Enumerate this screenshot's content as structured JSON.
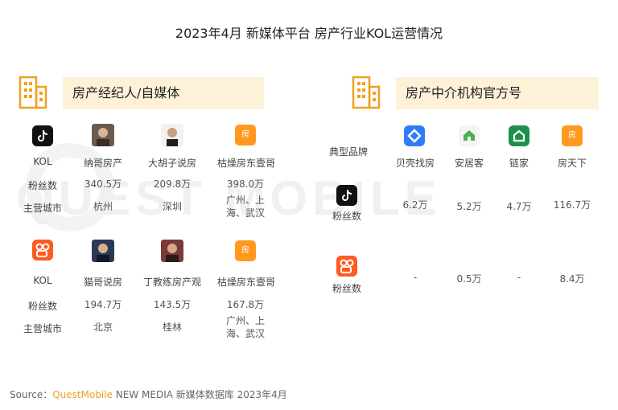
{
  "title": "2023年4月 新媒体平台 房产行业KOL运营情况",
  "watermark": "QUEST MOBILE",
  "left_section": {
    "header": "房产经纪人/自媒体",
    "row_labels": {
      "kol": "KOL",
      "fans": "粉丝数",
      "city": "主营城市"
    },
    "douyin": [
      {
        "name": "纳哥房产",
        "fans": "340.5万",
        "city": "杭州"
      },
      {
        "name": "大胡子说房",
        "fans": "209.8万",
        "city": "深圳"
      },
      {
        "name": "枯燥房东壹哥",
        "fans": "398.0万",
        "city_line1": "广州、上",
        "city_line2": "海、武汉"
      }
    ],
    "kuaishou": [
      {
        "name": "猫哥说房",
        "fans": "194.7万",
        "city": "北京"
      },
      {
        "name": "丁教练房产观",
        "fans": "143.5万",
        "city": "桂林"
      },
      {
        "name": "枯燥房东壹哥",
        "fans": "167.8万",
        "city_line1": "广州、上",
        "city_line2": "海、武汉"
      }
    ]
  },
  "right_section": {
    "header": "房产中介机构官方号",
    "brand_label": "典型品牌",
    "fans_label": "粉丝数",
    "brands": [
      "贝壳找房",
      "安居客",
      "链家",
      "房天下"
    ],
    "fang_glyph": "房",
    "douyin_fans": [
      "6.2万",
      "5.2万",
      "4.7万",
      "116.7万"
    ],
    "kuaishou_fans": [
      "-",
      "0.5万",
      "-",
      "8.4万"
    ]
  },
  "source": {
    "prefix": "Source：",
    "brand": "QuestMobile",
    "rest": " NEW MEDIA 新媒体数据库 2023年4月"
  },
  "colors": {
    "accent": "#f0a020",
    "section_bg": "#fdf1d8",
    "douyin": "#111111",
    "kuaishou": "#ff5a1f",
    "beike": "#2f7df6",
    "anjuke": "#4caf50",
    "lianjia": "#1f8f4e",
    "fangtianxia": "#ff9a1f"
  },
  "chart_data": {
    "type": "table",
    "title": "2023年4月 新媒体平台 房产行业KOL运营情况",
    "tables": [
      {
        "header": "房产经纪人/自媒体",
        "columns": [
          "KOL",
          "粉丝数",
          "主营城市"
        ],
        "rows": [
          [
            "纳哥房产",
            "340.5万",
            "杭州"
          ],
          [
            "大胡子说房",
            "209.8万",
            "深圳"
          ],
          [
            "枯燥房东壹哥",
            "398.0万",
            "广州、上海、武汉"
          ],
          [
            "猫哥说房",
            "194.7万",
            "北京"
          ],
          [
            "丁教练房产观",
            "143.5万",
            "桂林"
          ],
          [
            "枯燥房东壹哥",
            "167.8万",
            "广州、上海、武汉"
          ]
        ]
      },
      {
        "header": "房产中介机构官方号",
        "columns": [
          "典型品牌",
          "贝壳找房",
          "安居客",
          "链家",
          "房天下"
        ],
        "rows": [
          [
            "粉丝数",
            "6.2万",
            "5.2万",
            "4.7万",
            "116.7万"
          ],
          [
            "粉丝数",
            "-",
            "0.5万",
            "-",
            "8.4万"
          ]
        ]
      }
    ]
  }
}
